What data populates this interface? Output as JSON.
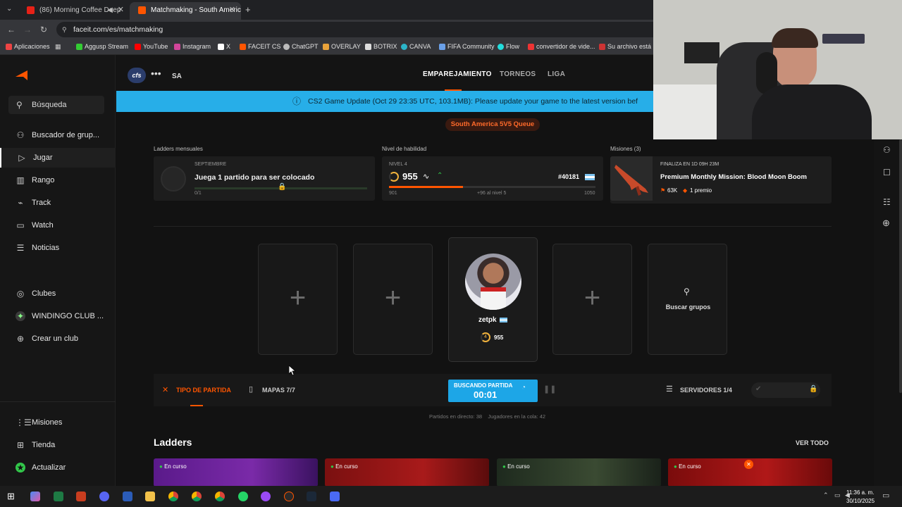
{
  "browser": {
    "tabs": [
      {
        "title": "(86) Morning Coffee Deep",
        "active": false
      },
      {
        "title": "Matchmaking - South America",
        "active": true
      }
    ],
    "url": "faceit.com/es/matchmaking",
    "bookmarks": [
      "Aplicaciones",
      "Aggusp Stream",
      "YouTube",
      "Instagram",
      "X",
      "FACEIT CS",
      "ChatGPT",
      "OVERLAY",
      "BOTRIX",
      "CANVA",
      "FIFA Community",
      "Flow",
      "convertidor de vide...",
      "Su archivo está lis"
    ]
  },
  "sidebar": {
    "search": "Búsqueda",
    "items": [
      "Buscador de grup...",
      "Jugar",
      "Rango",
      "Track",
      "Watch",
      "Noticias"
    ],
    "clubs": [
      "Clubes",
      "WINDINGO CLUB ...",
      "Crear un club"
    ],
    "bottom": [
      "Misiones",
      "Tienda",
      "Actualizar"
    ]
  },
  "topnav": {
    "game_tag": "cfs",
    "region": "SA",
    "links": [
      "EMPAREJAMIENTO",
      "TORNEOS",
      "LIGA"
    ]
  },
  "banner": "CS2 Game Update (Oct 29 23:35 UTC, 103.1MB): Please update your game to the latest version bef",
  "queue_badge": "South America 5V5 Queue",
  "ladders_mensuales": {
    "section": "Ladders mensuales",
    "month": "SEPTIEMBRE",
    "title": "Juega 1 partido para ser colocado",
    "progress": "0/1",
    "progress_fraction": 0
  },
  "skill": {
    "section": "Nivel de habilidad",
    "level_label": "NIVEL 4",
    "elo": "955",
    "rank": "#40181",
    "min": "901",
    "max": "1050",
    "to_next": "+96 al nivel 5",
    "progress_fraction": 0.36
  },
  "missions": {
    "section": "Misiones (3)",
    "ends": "FINALIZA EN 1D 09H 23M",
    "title": "Premium Monthly Mission: Blood Moon Boom",
    "reward_points": "63K",
    "reward_prize": "1 premio"
  },
  "party": {
    "player_name": "zetpk",
    "player_level": "4",
    "player_elo": "955",
    "search_groups": "Buscar grupos"
  },
  "controls": {
    "match_type": "TIPO DE PARTIDA",
    "maps": "MAPAS 7/7",
    "searching": "BUSCANDO PARTIDA",
    "timer": "00:01",
    "servers": "SERVIDORES 1/4",
    "stats": "Partidos en directo: 38    Jugadores en la cola: 42"
  },
  "ladders": {
    "title": "Ladders",
    "see_all": "VER TODO",
    "cards": [
      "En curso",
      "En curso",
      "En curso",
      "En curso"
    ]
  },
  "taskbar": {
    "time": "11:36 a. m.",
    "date": "30/10/2025"
  },
  "colors": {
    "accent": "#ff5500",
    "banner": "#27aee8",
    "search_button": "#1da6e7"
  }
}
